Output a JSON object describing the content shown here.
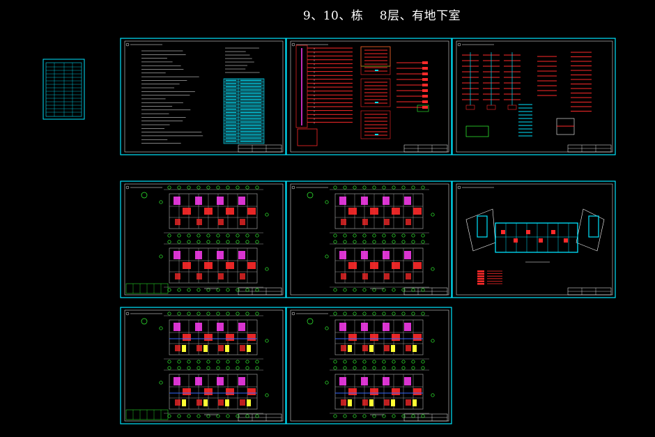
{
  "drawing_title": "9、10、栋　 8层、有地下室",
  "colors": {
    "background": "#000000",
    "frame": "#00e5ff",
    "inner_line": "#ffffff",
    "wiring": "#ff2a2a",
    "highlight": "#ff3df5",
    "accent": "#ffff33",
    "dim_line": "#9a9a9a",
    "axis_bubble": "#33ff33"
  },
  "sheets": [
    {
      "id": "sheet-design-notes",
      "kind": "notes"
    },
    {
      "id": "sheet-riser-diagram-a",
      "kind": "riser"
    },
    {
      "id": "sheet-riser-diagram-b",
      "kind": "riser"
    },
    {
      "id": "sheet-floor-plan-1",
      "kind": "plan"
    },
    {
      "id": "sheet-floor-plan-2",
      "kind": "plan"
    },
    {
      "id": "sheet-basement-plan",
      "kind": "basement"
    },
    {
      "id": "sheet-floor-plan-3",
      "kind": "plan"
    },
    {
      "id": "sheet-floor-plan-4",
      "kind": "plan"
    }
  ]
}
